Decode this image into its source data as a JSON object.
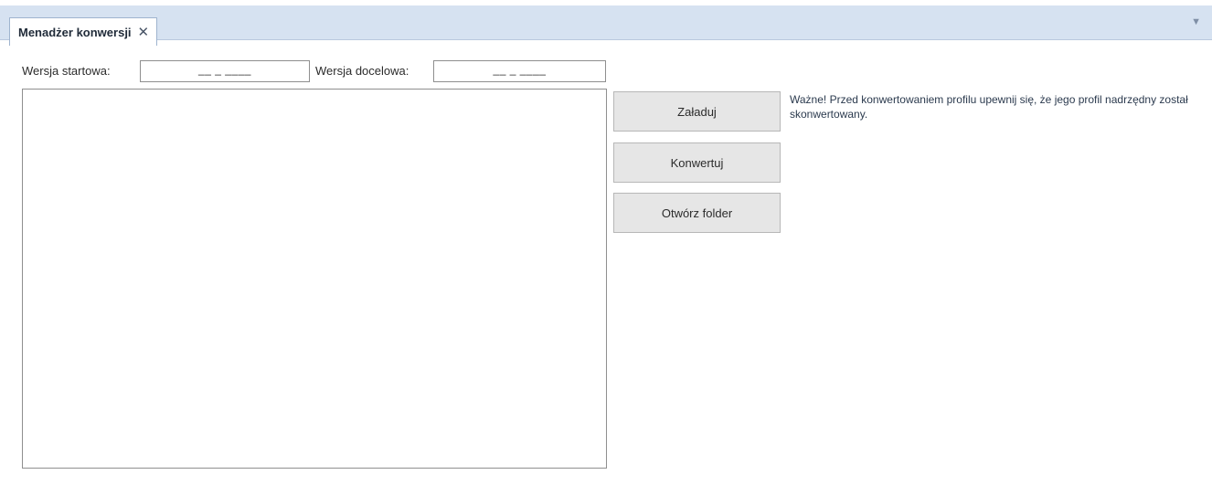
{
  "tab": {
    "title": "Menadżer konwersji",
    "close_glyph": "✕",
    "overflow_glyph": "▼"
  },
  "versions": {
    "start_label": "Wersja startowa:",
    "start_value": "__ _ ____",
    "target_label": "Wersja docelowa:",
    "target_value": "__ _ ____"
  },
  "actions": {
    "load_label": "Załaduj",
    "convert_label": "Konwertuj",
    "open_folder_label": "Otwórz folder"
  },
  "note": {
    "text": "Ważne! Przed konwertowaniem profilu upewnij się, że jego profil nadrzędny został skonwertowany."
  },
  "colors": {
    "tabstrip_bg": "#d6e2f1",
    "button_bg": "#e6e6e6",
    "note_text": "#2b3a4e"
  },
  "icons": {
    "tab_close": "close-icon",
    "tab_overflow": "chevron-down-icon"
  }
}
